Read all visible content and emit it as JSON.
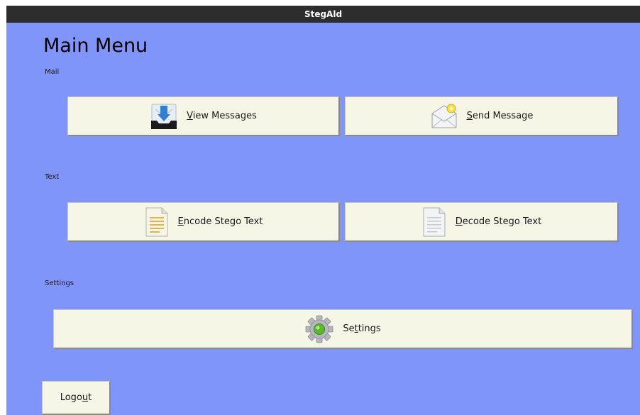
{
  "window": {
    "title": "StegAld"
  },
  "main": {
    "title": "Main Menu"
  },
  "sections": {
    "mail": {
      "label": "Mail",
      "view_messages": {
        "pre": "",
        "key": "V",
        "post": "iew Messages"
      },
      "send_message": {
        "pre": "",
        "key": "S",
        "post": "end Message"
      }
    },
    "text": {
      "label": "Text",
      "encode": {
        "pre": "",
        "key": "E",
        "post": "ncode Stego Text"
      },
      "decode": {
        "pre": "",
        "key": "D",
        "post": "ecode Stego Text"
      }
    },
    "settings": {
      "label": "Settings",
      "settings_button": {
        "pre": "Se",
        "key": "t",
        "post": "tings"
      }
    }
  },
  "logout": {
    "pre": "Logo",
    "key": "u",
    "post": "t"
  },
  "icons": {
    "view_messages": "inbox-download-icon",
    "send_message": "envelope-open-icon",
    "encode": "text-document-icon",
    "decode": "document-icon",
    "settings": "gear-icon"
  },
  "colors": {
    "background": "#7f95fa",
    "titlebar": "#2d2d2d",
    "button": "#f6f6e6"
  }
}
